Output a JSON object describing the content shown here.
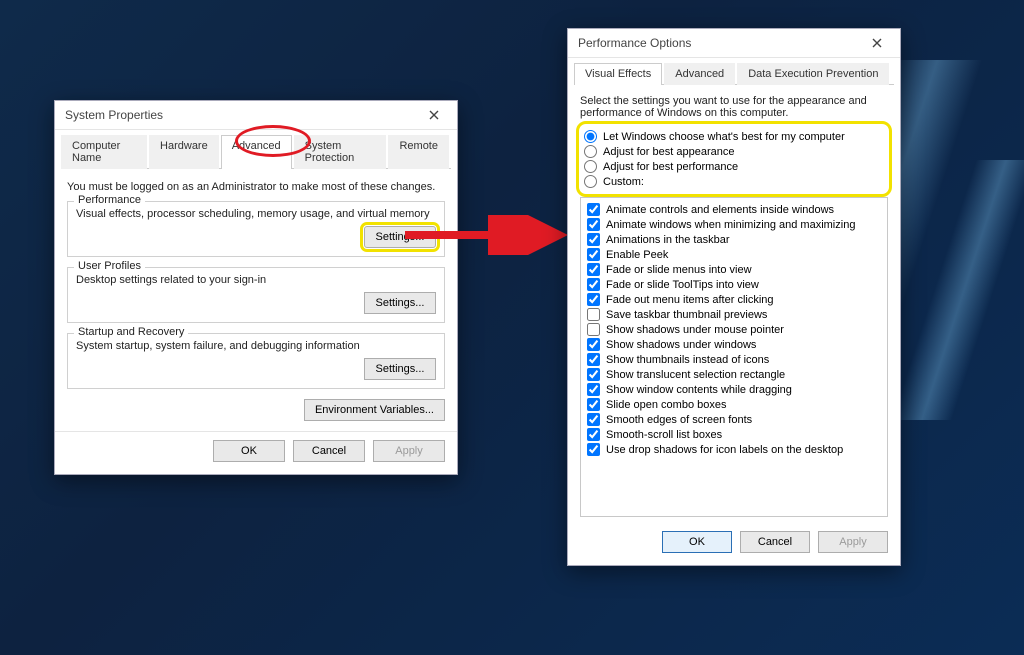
{
  "sysprops": {
    "title": "System Properties",
    "tabs": [
      "Computer Name",
      "Hardware",
      "Advanced",
      "System Protection",
      "Remote"
    ],
    "active_tab": 2,
    "admin_note": "You must be logged on as an Administrator to make most of these changes.",
    "groups": {
      "performance": {
        "legend": "Performance",
        "desc": "Visual effects, processor scheduling, memory usage, and virtual memory",
        "settings_btn": "Settings..."
      },
      "user_profiles": {
        "legend": "User Profiles",
        "desc": "Desktop settings related to your sign-in",
        "settings_btn": "Settings..."
      },
      "startup": {
        "legend": "Startup and Recovery",
        "desc": "System startup, system failure, and debugging information",
        "settings_btn": "Settings..."
      }
    },
    "env_btn": "Environment Variables...",
    "ok": "OK",
    "cancel": "Cancel",
    "apply": "Apply"
  },
  "perfopts": {
    "title": "Performance Options",
    "tabs": [
      "Visual Effects",
      "Advanced",
      "Data Execution Prevention"
    ],
    "active_tab": 0,
    "intro": "Select the settings you want to use for the appearance and performance of Windows on this computer.",
    "radios": [
      "Let Windows choose what's best for my computer",
      "Adjust for best appearance",
      "Adjust for best performance",
      "Custom:"
    ],
    "radio_selected": 0,
    "checks": [
      {
        "label": "Animate controls and elements inside windows",
        "checked": true
      },
      {
        "label": "Animate windows when minimizing and maximizing",
        "checked": true
      },
      {
        "label": "Animations in the taskbar",
        "checked": true
      },
      {
        "label": "Enable Peek",
        "checked": true
      },
      {
        "label": "Fade or slide menus into view",
        "checked": true
      },
      {
        "label": "Fade or slide ToolTips into view",
        "checked": true
      },
      {
        "label": "Fade out menu items after clicking",
        "checked": true
      },
      {
        "label": "Save taskbar thumbnail previews",
        "checked": false
      },
      {
        "label": "Show shadows under mouse pointer",
        "checked": false
      },
      {
        "label": "Show shadows under windows",
        "checked": true
      },
      {
        "label": "Show thumbnails instead of icons",
        "checked": true
      },
      {
        "label": "Show translucent selection rectangle",
        "checked": true
      },
      {
        "label": "Show window contents while dragging",
        "checked": true
      },
      {
        "label": "Slide open combo boxes",
        "checked": true
      },
      {
        "label": "Smooth edges of screen fonts",
        "checked": true
      },
      {
        "label": "Smooth-scroll list boxes",
        "checked": true
      },
      {
        "label": "Use drop shadows for icon labels on the desktop",
        "checked": true
      }
    ],
    "ok": "OK",
    "cancel": "Cancel",
    "apply": "Apply"
  }
}
